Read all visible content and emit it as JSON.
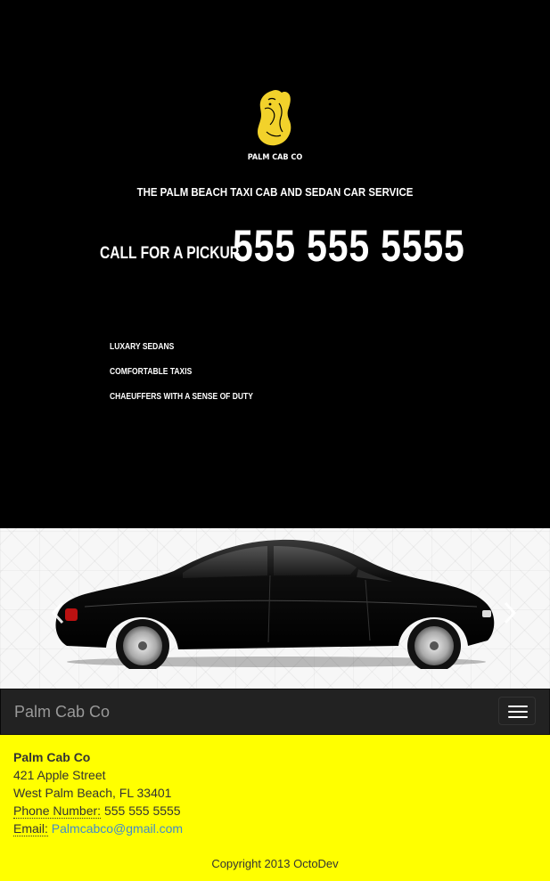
{
  "hero": {
    "logo_text": "PALM CAB CO",
    "tagline": "THE PALM BEACH TAXI CAB AND SEDAN CAR SERVICE",
    "call_label": "CALL FOR A PICKUP",
    "phone": "555 555 5555",
    "features": [
      "LUXARY SEDANS",
      "COMFORTABLE TAXIS",
      "CHAEUFFERS WITH A SENSE OF DUTY"
    ]
  },
  "carousel": {
    "prev_icon": "chevron-left-icon",
    "next_icon": "chevron-right-icon"
  },
  "navbar": {
    "brand": "Palm Cab Co",
    "toggle_icon": "hamburger-menu-icon"
  },
  "footer": {
    "company": "Palm Cab Co",
    "street": "421 Apple Street",
    "city": "West Palm Beach, FL 33401",
    "phone_label": "Phone Number:",
    "phone_value": "555 555 5555",
    "email_label": "Email:",
    "email_value": "Palmcabco@gmail.com",
    "copyright": "Copyright 2013 OctoDev"
  },
  "colors": {
    "hero_bg": "#000000",
    "logo_gold": "#f2d22b",
    "navbar_bg": "#222222",
    "footer_bg": "#ffff00",
    "link": "#428bca"
  }
}
